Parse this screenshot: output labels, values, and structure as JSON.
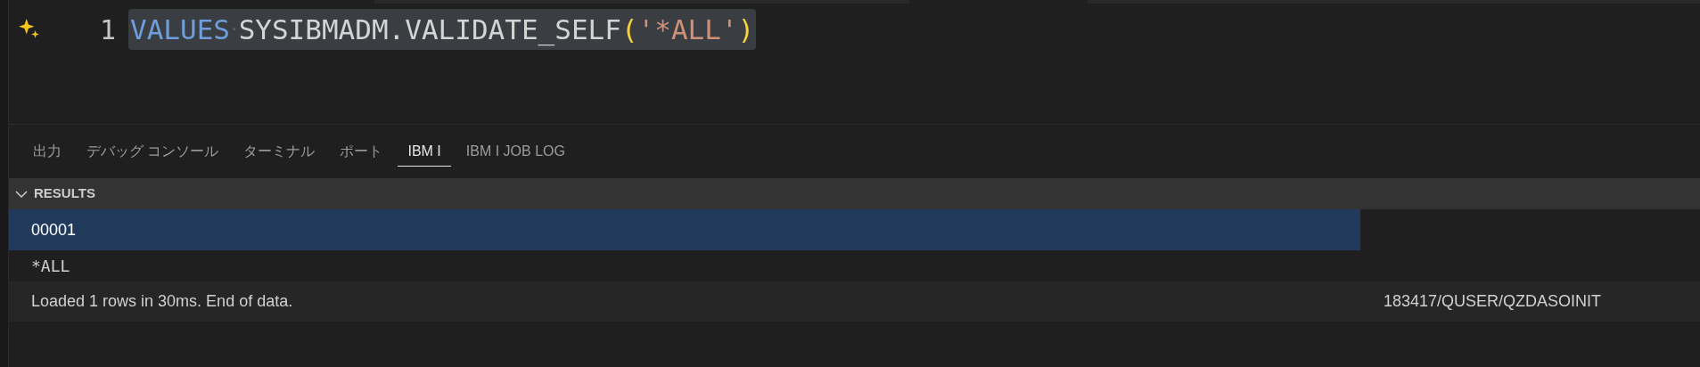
{
  "editor": {
    "lines": [
      {
        "number": "1",
        "tokens": [
          {
            "kind": "keyword",
            "text": "VALUES"
          },
          {
            "kind": "space",
            "text": "·"
          },
          {
            "kind": "plain",
            "text": "SYSIBMADM.VALIDATE_SELF"
          },
          {
            "kind": "bracket",
            "text": "("
          },
          {
            "kind": "string",
            "text": "'*ALL'"
          },
          {
            "kind": "bracket",
            "text": ")"
          }
        ],
        "selected": true
      }
    ]
  },
  "panel": {
    "tabs": [
      {
        "label": "出力",
        "selected": false
      },
      {
        "label": "デバッグ コンソール",
        "selected": false
      },
      {
        "label": "ターミナル",
        "selected": false
      },
      {
        "label": "ポート",
        "selected": false
      },
      {
        "label": "IBM I",
        "selected": true
      },
      {
        "label": "IBM I JOB LOG",
        "selected": false
      }
    ],
    "results": {
      "title": "RESULTS",
      "expanded": true,
      "rows": [
        {
          "cells": [
            "00001"
          ],
          "selected": true,
          "kind": "header"
        },
        {
          "cells": [
            "*ALL"
          ],
          "selected": false,
          "kind": "value"
        },
        {
          "cells": [
            "Loaded 1 rows in 30ms. End of data.",
            "183417/QUSER/QZDASOINIT"
          ],
          "selected": false,
          "kind": "status"
        }
      ]
    }
  }
}
